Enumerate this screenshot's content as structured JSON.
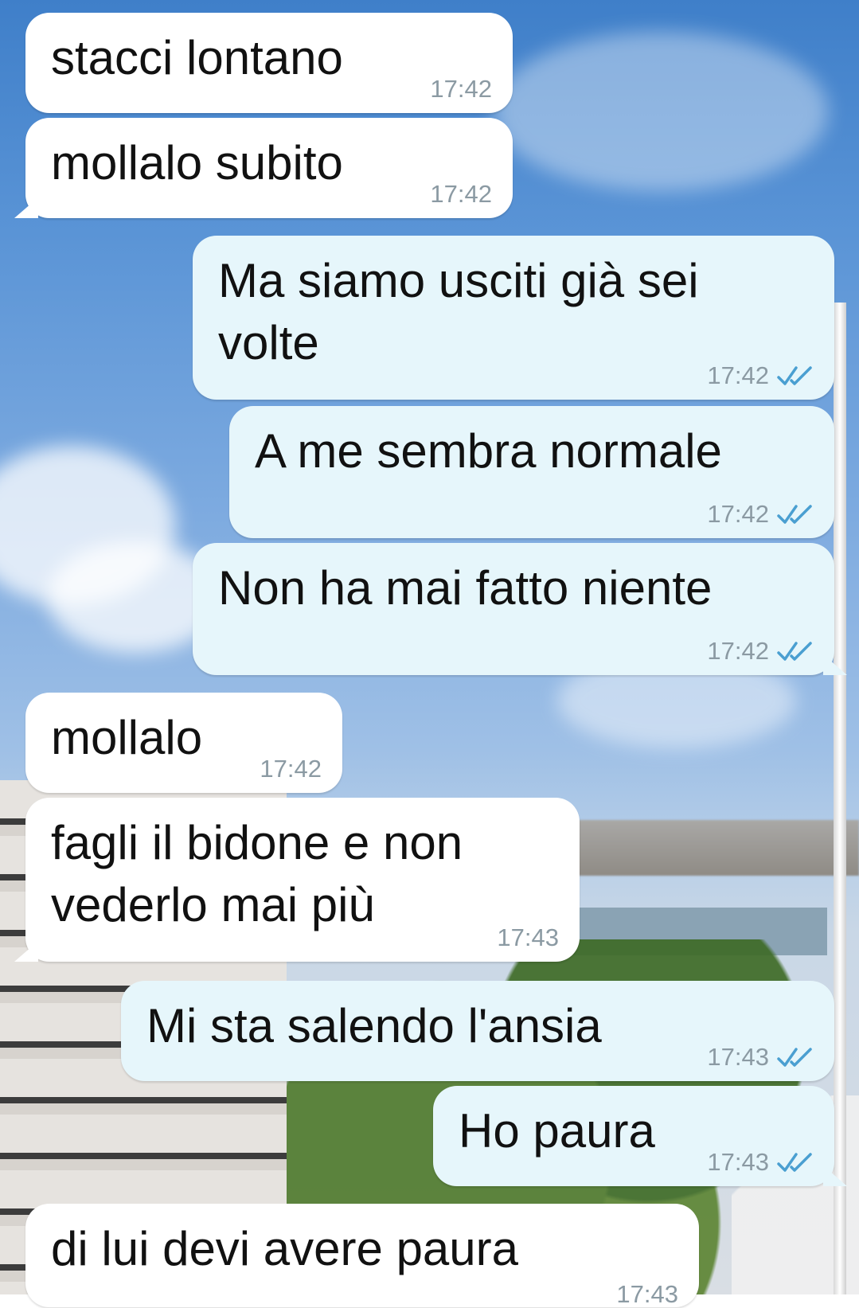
{
  "messages": [
    {
      "direction": "in",
      "text": "stacci lontano",
      "time": "17:42"
    },
    {
      "direction": "in",
      "text": "mollalo subito",
      "time": "17:42"
    },
    {
      "direction": "out",
      "text": "Ma siamo usciti già sei volte",
      "time": "17:42",
      "status": "read-double-check-icon"
    },
    {
      "direction": "out",
      "text": "A me sembra normale",
      "time": "17:42",
      "status": "read-double-check-icon"
    },
    {
      "direction": "out",
      "text": "Non ha mai fatto niente",
      "time": "17:42",
      "status": "read-double-check-icon"
    },
    {
      "direction": "in",
      "text": "mollalo",
      "time": "17:42"
    },
    {
      "direction": "in",
      "text": "fagli il bidone e non vederlo mai più",
      "time": "17:43"
    },
    {
      "direction": "out",
      "text": "Mi sta salendo l'ansia",
      "time": "17:43",
      "status": "read-double-check-icon"
    },
    {
      "direction": "out",
      "text": "Ho paura",
      "time": "17:43",
      "status": "read-double-check-icon"
    },
    {
      "direction": "in",
      "text": "di lui devi avere paura",
      "time": "17:43"
    }
  ],
  "colors": {
    "incoming_bubble": "#ffffff",
    "outgoing_bubble": "#e6f6fb",
    "timestamp": "#8b9aa3",
    "read_tick": "#4a9fd1"
  }
}
